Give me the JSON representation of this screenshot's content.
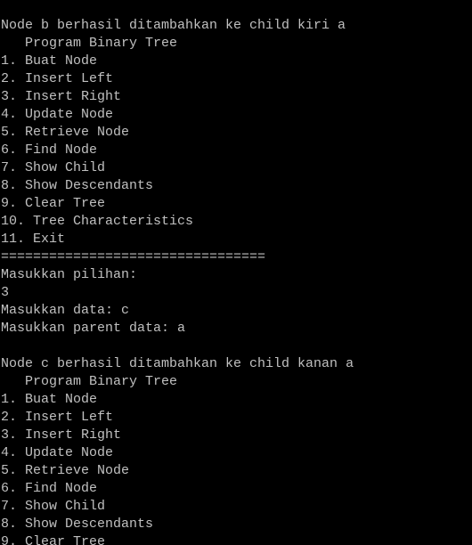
{
  "terminal": {
    "lines": [
      "Node b berhasil ditambahkan ke child kiri a",
      "   Program Binary Tree",
      "1. Buat Node",
      "2. Insert Left",
      "3. Insert Right",
      "4. Update Node",
      "5. Retrieve Node",
      "6. Find Node",
      "7. Show Child",
      "8. Show Descendants",
      "9. Clear Tree",
      "10. Tree Characteristics",
      "11. Exit",
      "=================================",
      "Masukkan pilihan:",
      "3",
      "Masukkan data: c",
      "Masukkan parent data: a",
      "",
      "Node c berhasil ditambahkan ke child kanan a",
      "   Program Binary Tree",
      "1. Buat Node",
      "2. Insert Left",
      "3. Insert Right",
      "4. Update Node",
      "5. Retrieve Node",
      "6. Find Node",
      "7. Show Child",
      "8. Show Descendants",
      "9. Clear Tree"
    ]
  },
  "colors": {
    "background": "#000000",
    "text": "#c0c0c0"
  }
}
